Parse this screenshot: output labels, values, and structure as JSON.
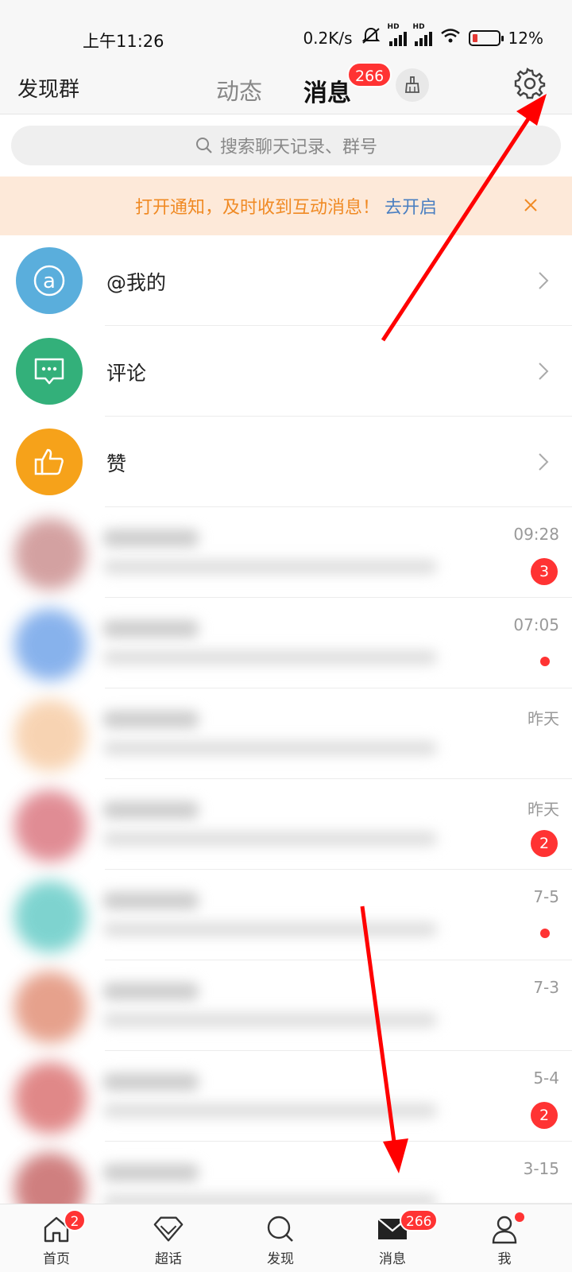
{
  "status_bar": {
    "time": "上午11:26",
    "net_speed": "0.2K/s",
    "hd": "HD",
    "battery": "12%"
  },
  "top_nav": {
    "left_link": "发现群",
    "tab_dynamic": "动态",
    "tab_messages": "消息",
    "messages_badge": "266",
    "accent": "#f5a623"
  },
  "search": {
    "placeholder": "搜索聊天记录、群号"
  },
  "notify_banner": {
    "text": "打开通知，及时收到互动消息！",
    "link": "去开启"
  },
  "features": [
    {
      "label": "@我的",
      "icon": "at-icon",
      "color": "#5aaedc"
    },
    {
      "label": "评论",
      "icon": "comment-icon",
      "color": "#33b07a"
    },
    {
      "label": "赞",
      "icon": "thumbs-up-icon",
      "color": "#f6a21a"
    }
  ],
  "chats": [
    {
      "time": "09:28",
      "badge": "3",
      "dot": false,
      "avatar_color": "#c98a8a"
    },
    {
      "time": "07:05",
      "badge": "",
      "dot": true,
      "avatar_color": "#6a9fe8"
    },
    {
      "time": "昨天",
      "badge": "",
      "dot": false,
      "avatar_color": "#f6c9a0"
    },
    {
      "time": "昨天",
      "badge": "2",
      "dot": false,
      "avatar_color": "#d9707a"
    },
    {
      "time": "7-5",
      "badge": "",
      "dot": true,
      "avatar_color": "#5ec9c4"
    },
    {
      "time": "7-3",
      "badge": "",
      "dot": false,
      "avatar_color": "#e08a70"
    },
    {
      "time": "5-4",
      "badge": "2",
      "dot": false,
      "avatar_color": "#d96b6b"
    },
    {
      "time": "3-15",
      "badge": "",
      "dot": false,
      "avatar_color": "#c46060"
    }
  ],
  "bottom_nav": {
    "home": "首页",
    "home_badge": "2",
    "super": "超话",
    "discover": "发现",
    "messages": "消息",
    "messages_badge": "266",
    "me": "我"
  }
}
